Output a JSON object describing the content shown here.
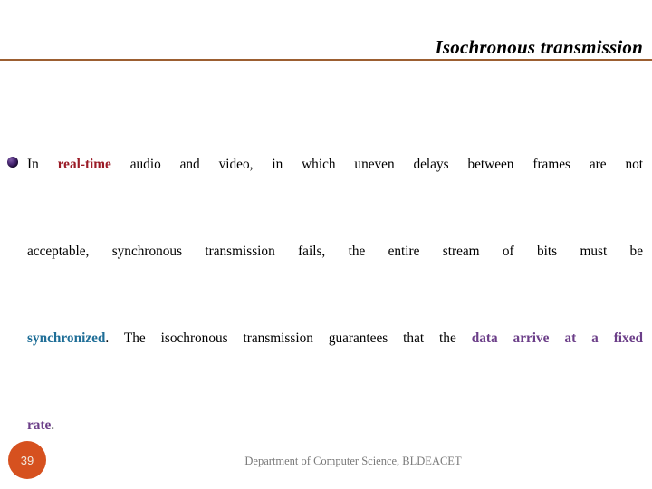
{
  "slide": {
    "title": "Isochronous transmission",
    "rule_color": "#9C5F31",
    "background": "#ffffff"
  },
  "content": {
    "bullet_icon": "bullet-sphere-icon",
    "line1_a": "In ",
    "line1_b": "real-time",
    "line1_c": " audio and video, in which uneven delays between frames are not",
    "line2": "acceptable, synchronous transmission fails, the entire stream of bits must be",
    "line3_a": "synchronized",
    "line3_b": ". The isochronous transmission guarantees that the ",
    "line3_c": "data arrive at a fixed",
    "line4_a": "rate",
    "line4_b": ".",
    "emphasis_colors": {
      "real_time": "#9B1C27",
      "synchronized": "#1F6E97",
      "data_arrive": "#6C3F89"
    }
  },
  "footer": {
    "page_number": "39",
    "page_badge_color": "#D6511F",
    "note": "Department of Computer Science, BLDEACET"
  }
}
